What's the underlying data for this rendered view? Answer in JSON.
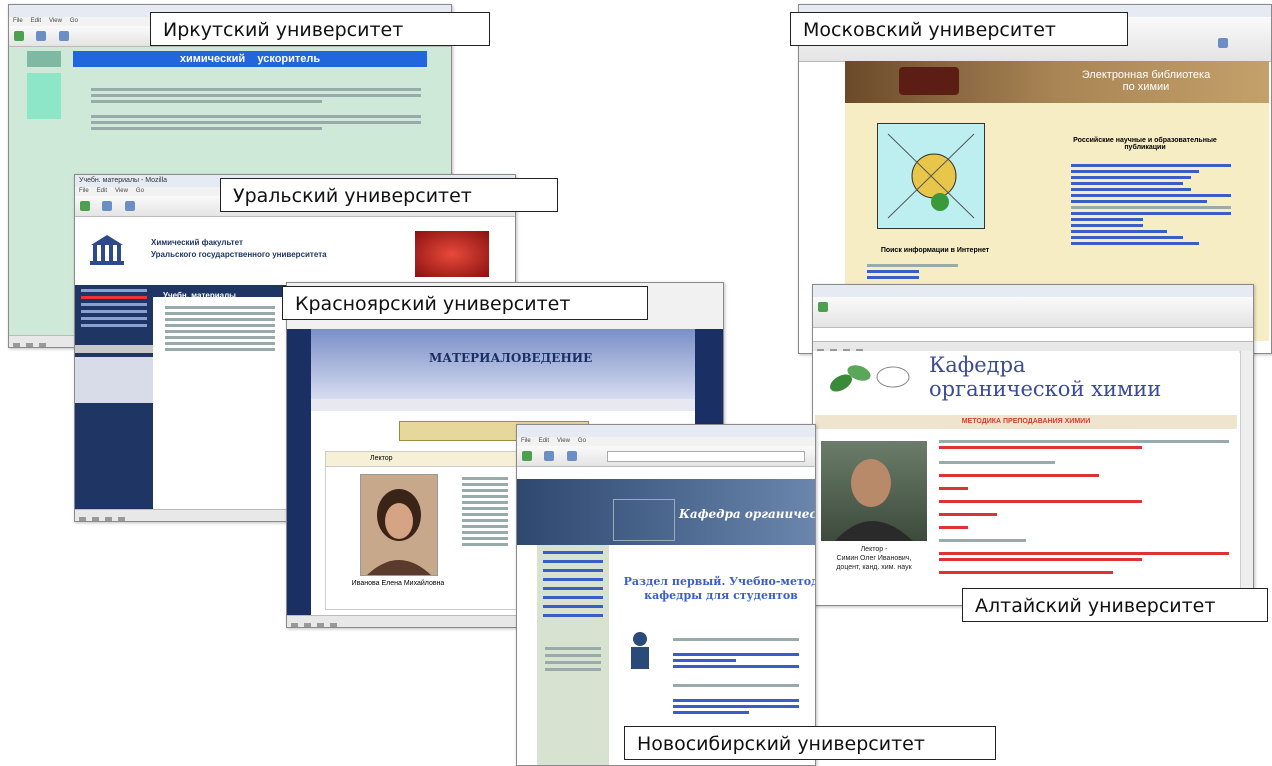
{
  "labels": {
    "irkutsk": "Иркутский университет",
    "moscow": "Московский университет",
    "ural": "Уральский университет",
    "krasnoyarsk": "Красноярский университет",
    "altai": "Алтайский университет",
    "novosibirsk": "Новосибирский университет"
  },
  "irkutsk_site": {
    "banner_left": "химический",
    "banner_right": "ускоритель"
  },
  "ural_site": {
    "window_title": "Учебн. материалы - Mozilla",
    "heading_line1": "Химический факультет",
    "heading_line2": "Уральского государственного университета",
    "section_title": "Учебн. материалы"
  },
  "moscow_site": {
    "header_line1": "Электронная библиотека",
    "header_line2": "по химии",
    "caption": "Поиск информации в Интернет",
    "list_title": "Российские научные и образовательные публикации"
  },
  "krasnoyarsk_site": {
    "banner_title": "МАТЕРИАЛОВЕДЕНИЕ",
    "table_header": "Лектор",
    "lecturer_caption": "Иванова Елена Михайловна"
  },
  "altai_site": {
    "dept_title_line1": "Кафедра",
    "dept_title_line2": "органической химии",
    "subtitle": "МЕТОДИКА ПРЕПОДАВАНИЯ ХИМИИ",
    "photo_caption_line1": "Лектор -",
    "photo_caption_line2": "Симин Олег Иванович,",
    "photo_caption_line3": "доцент, канд. хим. наук"
  },
  "novosibirsk_site": {
    "header_title": "Кафедра органической",
    "section_title_line1": "Раздел первый. Учебно-метод",
    "section_title_line2": "кафедры для студентов"
  },
  "colors": {
    "irkutsk_bg": "#cfe9d9",
    "irkutsk_banner": "#2266dd",
    "ural_nav": "#1f3563",
    "moscow_bg": "#f7edc4",
    "krasnoyarsk_navy": "#1a2f63",
    "altai_title": "#3c4a9a",
    "altai_red": "#d63b2a",
    "novosibirsk_header": "#4b6891"
  }
}
